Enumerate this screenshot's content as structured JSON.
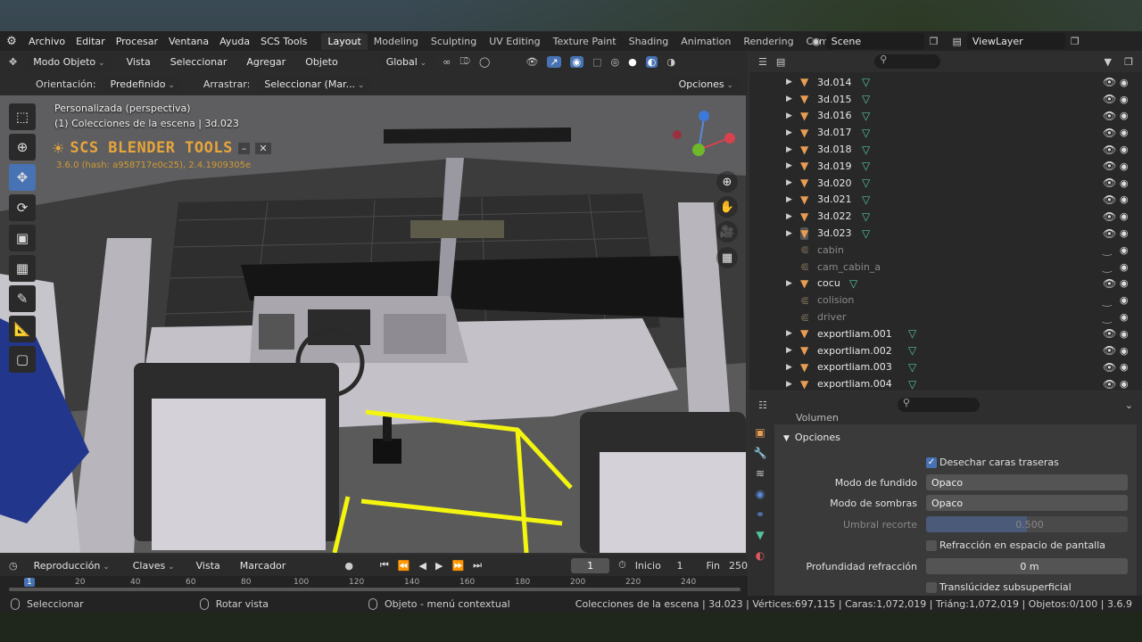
{
  "menu": {
    "items": [
      "Archivo",
      "Editar",
      "Procesar",
      "Ventana",
      "Ayuda",
      "SCS Tools"
    ],
    "workspaces": [
      "Layout",
      "Modeling",
      "Sculpting",
      "UV Editing",
      "Texture Paint",
      "Shading",
      "Animation",
      "Rendering",
      "Composit"
    ],
    "active_workspace": "Layout",
    "scene": "Scene",
    "view_layer": "ViewLayer"
  },
  "viewport_header": {
    "mode": "Modo Objeto",
    "menus": [
      "Vista",
      "Seleccionar",
      "Agregar",
      "Objeto"
    ],
    "transform": "Global",
    "orientation_label": "Orientación:",
    "orientation_value": "Predefinido",
    "drag_label": "Arrastrar:",
    "drag_value": "Seleccionar (Mar...",
    "options": "Opciones"
  },
  "viewport": {
    "view_name": "Personalizada (perspectiva)",
    "collection_info": "(1) Colecciones de la escena | 3d.023",
    "scs_title": "SCS BLENDER TOOLS",
    "scs_hash": "3.6.0 (hash: a958717e0c25), 2.4.1909305e"
  },
  "timeline": {
    "playback": "Reproducción",
    "keys": "Claves",
    "view": "Vista",
    "marker": "Marcador",
    "current_frame": "1",
    "start_label": "Inicio",
    "start": "1",
    "end_label": "Fin",
    "end": "250",
    "ruler": [
      "1",
      "20",
      "40",
      "60",
      "80",
      "100",
      "120",
      "140",
      "160",
      "180",
      "200",
      "220",
      "240"
    ]
  },
  "statusbar": {
    "select": "Seleccionar",
    "rotate": "Rotar vista",
    "context": "Objeto - menú contextual",
    "stats": "Colecciones de la escena | 3d.023 | Vértices:697,115 | Caras:1,072,019 | Triáng:1,072,019 | Objetos:0/100 | 3.6.9"
  },
  "outliner": {
    "rows": [
      {
        "name": "3d.014",
        "kind": "obj"
      },
      {
        "name": "3d.015",
        "kind": "obj"
      },
      {
        "name": "3d.016",
        "kind": "obj"
      },
      {
        "name": "3d.017",
        "kind": "obj"
      },
      {
        "name": "3d.018",
        "kind": "obj"
      },
      {
        "name": "3d.019",
        "kind": "obj"
      },
      {
        "name": "3d.020",
        "kind": "obj"
      },
      {
        "name": "3d.021",
        "kind": "obj"
      },
      {
        "name": "3d.022",
        "kind": "obj"
      },
      {
        "name": "3d.023",
        "kind": "obj"
      },
      {
        "name": "cabin",
        "kind": "empty"
      },
      {
        "name": "cam_cabin_a",
        "kind": "empty"
      },
      {
        "name": "cocu",
        "kind": "obj"
      },
      {
        "name": "colision",
        "kind": "empty"
      },
      {
        "name": "driver",
        "kind": "empty"
      },
      {
        "name": "exportliam.001",
        "kind": "obj"
      },
      {
        "name": "exportliam.002",
        "kind": "obj"
      },
      {
        "name": "exportliam.003",
        "kind": "obj"
      },
      {
        "name": "exportliam.004",
        "kind": "obj"
      }
    ]
  },
  "properties": {
    "section_cut": "Volumen",
    "section": "Opciones",
    "backface_culling": "Desechar caras traseras",
    "blend_mode_label": "Modo de fundido",
    "blend_mode": "Opaco",
    "shadow_mode_label": "Modo de sombras",
    "shadow_mode": "Opaco",
    "clip_threshold_label": "Umbral recorte",
    "clip_threshold": "0.500",
    "screen_refraction": "Refracción en espacio de pantalla",
    "refraction_depth_label": "Profundidad refracción",
    "refraction_depth": "0 m",
    "subsurface": "Translúcidez subsuperficial"
  },
  "colors": {
    "accent_blue": "#4772b3",
    "object_orange": "#e89d54",
    "mesh_green": "#54c29d",
    "scs_orange": "#e8a53a"
  }
}
